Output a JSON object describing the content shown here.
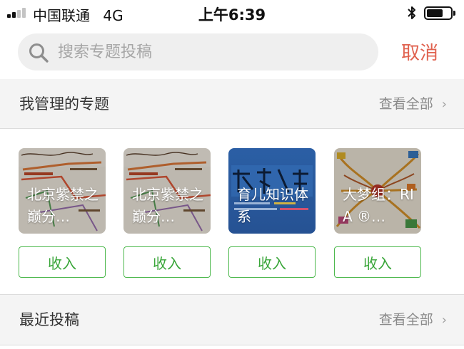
{
  "status_bar": {
    "carrier": "中国联通",
    "network": "4G",
    "time": "上午6:39",
    "battery_level": 0.6
  },
  "search": {
    "placeholder": "搜索专题投稿",
    "value": "",
    "cancel_label": "取消"
  },
  "managed_topics": {
    "title": "我管理的专题",
    "view_all": "查看全部",
    "items": [
      {
        "title": "北京紫禁之巅分…",
        "button": "收入"
      },
      {
        "title": "北京紫禁之巅分…",
        "button": "收入"
      },
      {
        "title": "育儿知识体系",
        "button": "收入"
      },
      {
        "title": "大梦组：RIA ®…",
        "button": "收入"
      }
    ]
  },
  "recent_posts": {
    "title": "最近投稿",
    "view_all": "查看全部"
  },
  "colors": {
    "accent_red": "#e0624f",
    "accent_green": "#4cb84c",
    "section_bg": "#f4f4f4"
  },
  "icons": [
    "signal-icon",
    "bluetooth-icon",
    "battery-icon",
    "search-icon",
    "chevron-right-icon"
  ]
}
